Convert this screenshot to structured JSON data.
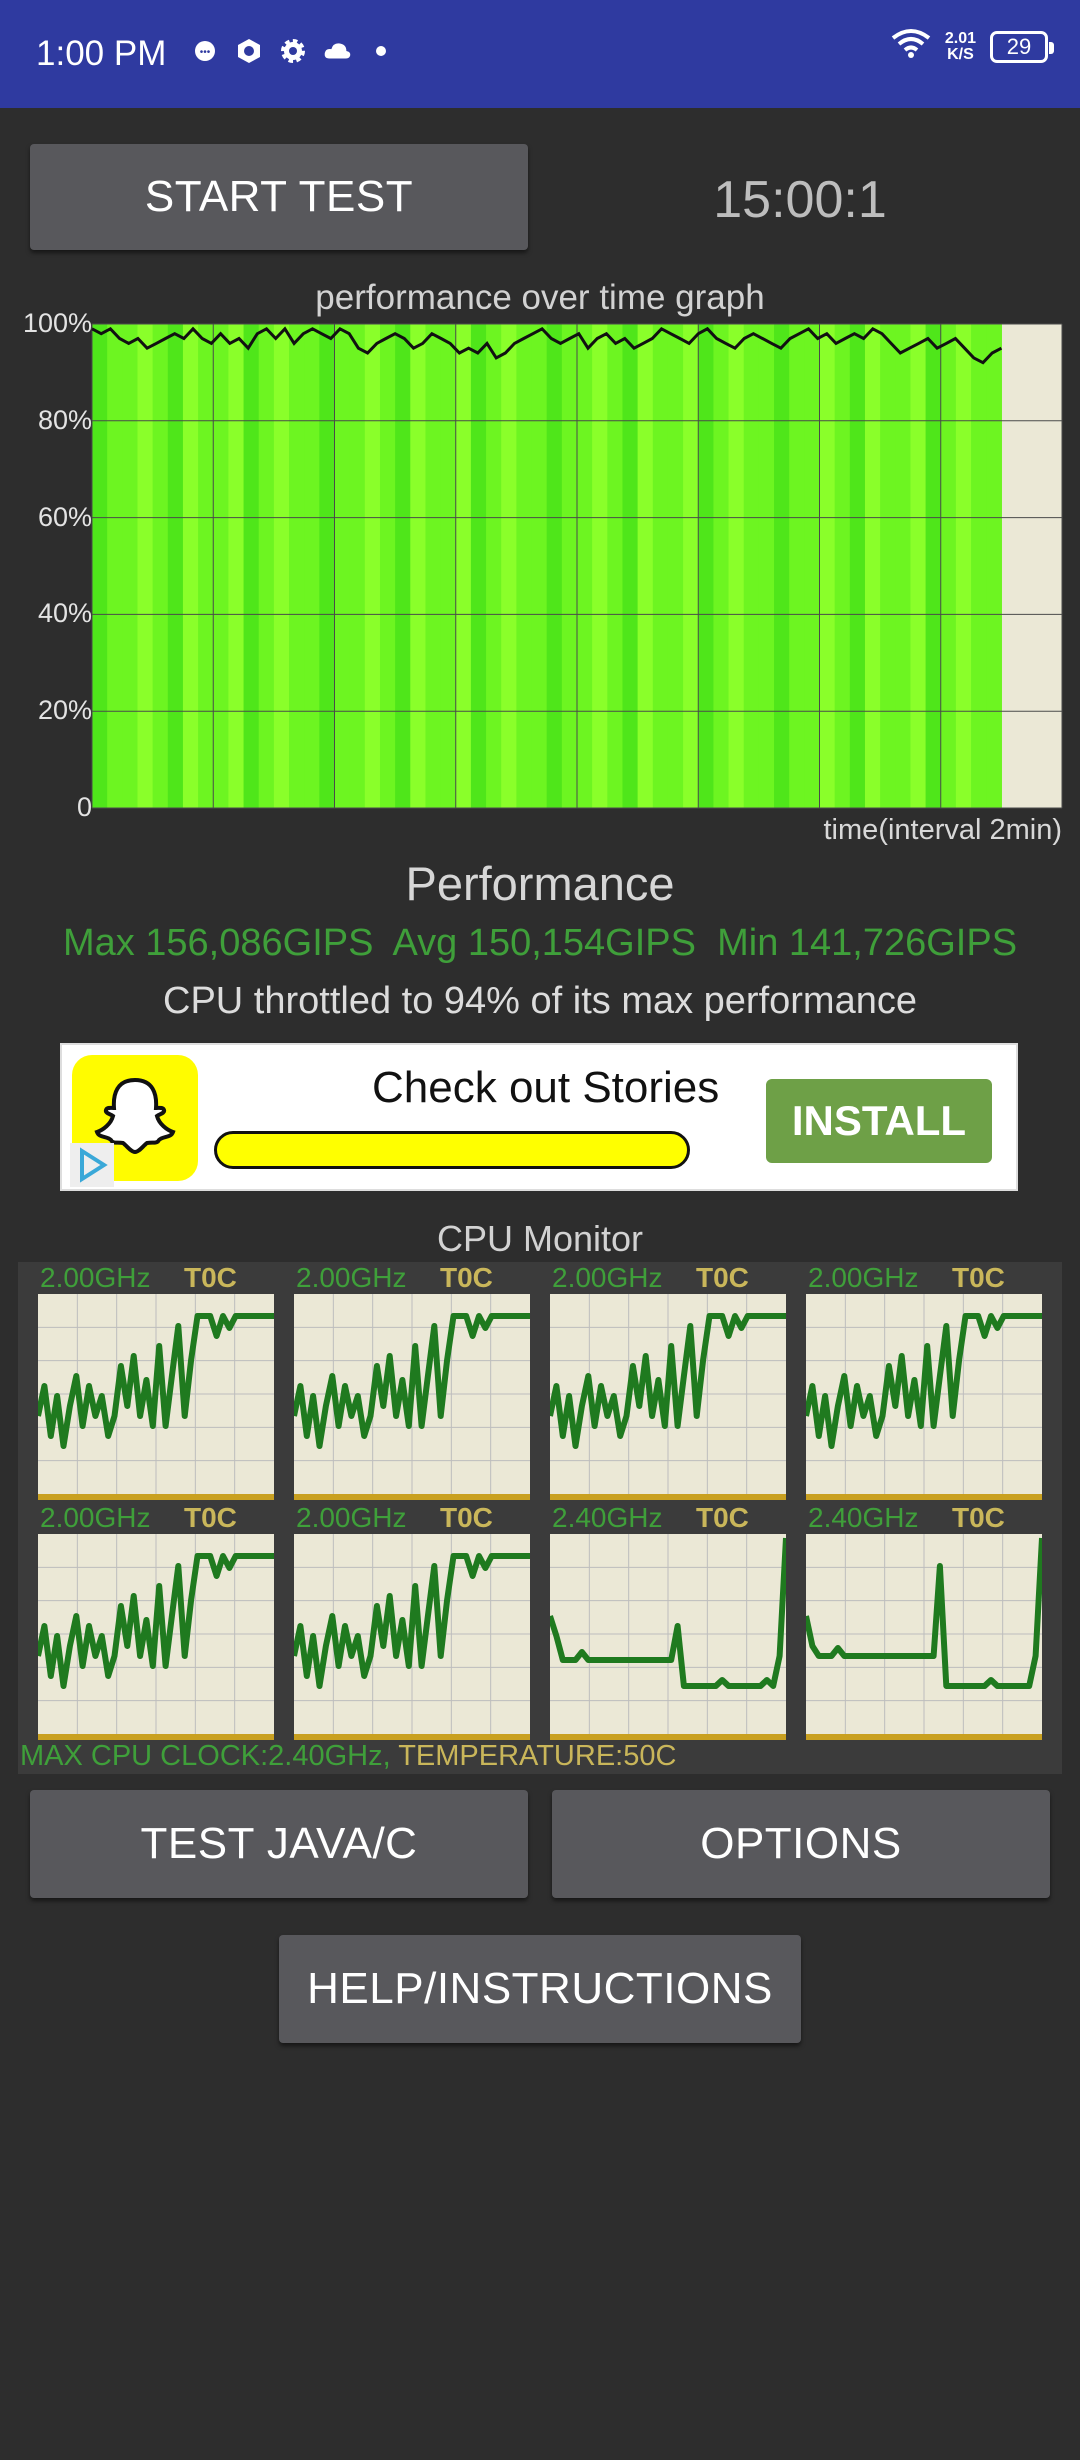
{
  "status_bar": {
    "time": "1:00 PM",
    "speed_value": "2.01",
    "speed_unit": "K/S",
    "battery": "29"
  },
  "controls": {
    "start_test": "START TEST",
    "timer": "15:00:1",
    "test_java_c": "TEST JAVA/C",
    "options": "OPTIONS",
    "help": "HELP/INSTRUCTIONS"
  },
  "graph": {
    "title": "performance over time graph",
    "time_label": "time(interval 2min)",
    "y_ticks": [
      "100%",
      "80%",
      "60%",
      "40%",
      "20%",
      "0"
    ]
  },
  "chart_data": {
    "type": "area",
    "title": "performance over time graph",
    "xlabel": "time(interval 2min)",
    "ylabel": "",
    "ylim": [
      0,
      100
    ],
    "x_count": 7.5,
    "grid": true,
    "values": [
      99,
      98,
      99,
      97,
      96,
      97,
      95,
      96,
      97,
      98,
      97,
      99,
      97,
      96,
      98,
      96,
      97,
      95,
      98,
      99,
      97,
      99,
      96,
      98,
      99,
      98,
      97,
      99,
      98,
      95,
      94,
      96,
      97,
      98,
      97,
      95,
      96,
      98,
      97,
      96,
      94,
      95,
      94,
      96,
      93,
      94,
      96,
      97,
      98,
      99,
      97,
      96,
      97,
      98,
      95,
      97,
      98,
      96,
      97,
      95,
      96,
      97,
      99,
      98,
      97,
      96,
      98,
      99,
      97,
      96,
      95,
      97,
      98,
      97,
      96,
      95,
      97,
      98,
      99,
      97,
      98,
      96,
      97,
      98,
      97,
      99,
      98,
      96,
      94,
      95,
      96,
      97,
      95,
      96,
      97,
      95,
      93,
      92,
      94,
      95
    ]
  },
  "performance": {
    "title": "Performance",
    "stats": "Max 156,086GIPS  Avg 150,154GIPS  Min 141,726GIPS",
    "throttle": "CPU throttled to 94% of its max performance"
  },
  "ad": {
    "text": "Check out Stories",
    "install": "INSTALL"
  },
  "cpu_monitor": {
    "title": "CPU Monitor",
    "cores": [
      {
        "freq": "2.00GHz",
        "temp": "T0C",
        "values": [
          40,
          55,
          30,
          50,
          25,
          45,
          60,
          35,
          55,
          40,
          50,
          30,
          40,
          65,
          45,
          70,
          40,
          58,
          35,
          75,
          35,
          60,
          85,
          40,
          68,
          90,
          90,
          90,
          80,
          90,
          84,
          90,
          90,
          90,
          90,
          90,
          90,
          90
        ]
      },
      {
        "freq": "2.00GHz",
        "temp": "T0C",
        "values": [
          40,
          55,
          30,
          50,
          25,
          45,
          60,
          35,
          55,
          40,
          50,
          30,
          40,
          65,
          45,
          70,
          40,
          58,
          35,
          75,
          35,
          60,
          85,
          40,
          68,
          90,
          90,
          90,
          80,
          90,
          84,
          90,
          90,
          90,
          90,
          90,
          90,
          90
        ]
      },
      {
        "freq": "2.00GHz",
        "temp": "T0C",
        "values": [
          40,
          55,
          30,
          50,
          25,
          45,
          60,
          35,
          55,
          40,
          50,
          30,
          40,
          65,
          45,
          70,
          40,
          58,
          35,
          75,
          35,
          60,
          85,
          40,
          68,
          90,
          90,
          90,
          80,
          90,
          84,
          90,
          90,
          90,
          90,
          90,
          90,
          90
        ]
      },
      {
        "freq": "2.00GHz",
        "temp": "T0C",
        "values": [
          40,
          55,
          30,
          50,
          25,
          45,
          60,
          35,
          55,
          40,
          50,
          30,
          40,
          65,
          45,
          70,
          40,
          58,
          35,
          75,
          35,
          60,
          85,
          40,
          68,
          90,
          90,
          90,
          80,
          90,
          84,
          90,
          90,
          90,
          90,
          90,
          90,
          90
        ]
      },
      {
        "freq": "2.00GHz",
        "temp": "T0C",
        "values": [
          40,
          55,
          30,
          50,
          25,
          45,
          60,
          35,
          55,
          40,
          50,
          30,
          40,
          65,
          45,
          70,
          40,
          58,
          35,
          75,
          35,
          60,
          85,
          40,
          68,
          90,
          90,
          90,
          80,
          90,
          84,
          90,
          90,
          90,
          90,
          90,
          90,
          90
        ]
      },
      {
        "freq": "2.00GHz",
        "temp": "T0C",
        "values": [
          40,
          55,
          30,
          50,
          25,
          45,
          60,
          35,
          55,
          40,
          50,
          30,
          40,
          65,
          45,
          70,
          40,
          58,
          35,
          75,
          35,
          60,
          85,
          40,
          68,
          90,
          90,
          90,
          80,
          90,
          84,
          90,
          90,
          90,
          90,
          90,
          90,
          90
        ]
      },
      {
        "freq": "2.40GHz",
        "temp": "T0C",
        "values": [
          60,
          50,
          38,
          38,
          38,
          42,
          38,
          38,
          38,
          38,
          38,
          38,
          38,
          38,
          38,
          38,
          38,
          38,
          38,
          38,
          55,
          25,
          25,
          25,
          25,
          25,
          25,
          28,
          25,
          25,
          25,
          25,
          25,
          25,
          28,
          25,
          40,
          99
        ]
      },
      {
        "freq": "2.40GHz",
        "temp": "T0C",
        "values": [
          60,
          45,
          40,
          40,
          40,
          44,
          40,
          40,
          40,
          40,
          40,
          40,
          40,
          40,
          40,
          40,
          40,
          40,
          40,
          40,
          40,
          85,
          25,
          25,
          25,
          25,
          25,
          25,
          25,
          28,
          25,
          25,
          25,
          25,
          25,
          25,
          40,
          99
        ]
      }
    ],
    "footer_clock": "MAX CPU CLOCK:2.40GHz,",
    "footer_temp": " TEMPERATURE:50C"
  },
  "colors": {
    "status_bar": "#2f3aa0",
    "graph_green": "#7aff1e",
    "graph_bg": "#ebe8d6",
    "cpu_line": "#1f7a1f",
    "accent_green": "#3f9f3a",
    "accent_yellow": "#c9b65a"
  }
}
